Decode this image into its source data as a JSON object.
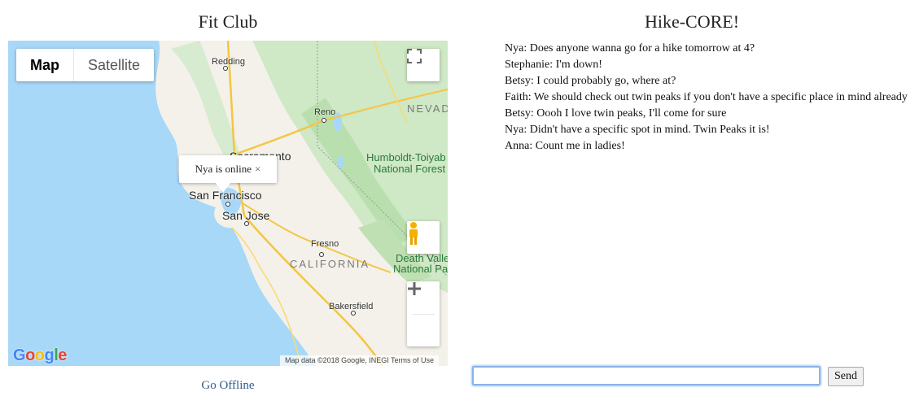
{
  "left_title": "Fit Club",
  "right_title": "Hike-CORE!",
  "map": {
    "type_control": {
      "map_label": "Map",
      "satellite_label": "Satellite",
      "selected": "Map"
    },
    "info_window": {
      "text": "Nya is online",
      "close_glyph": "×"
    },
    "labels": {
      "redding": "Redding",
      "reno": "Reno",
      "nevada": "NEVAD",
      "sacramento": "Sacramento",
      "san_francisco": "San Francisco",
      "san_jose": "San Jose",
      "fresno": "Fresno",
      "california": "CALIFORNIA",
      "bakersfield": "Bakersfield",
      "humboldt": "Humboldt-Toiyab",
      "humboldt2": "National Forest",
      "death_valley": "Death Valle",
      "death_valley2": "National Pa"
    },
    "attribution": "Map data ©2018 Google, INEGI    Terms of Use",
    "logo": "Google",
    "zoom_in": "+",
    "zoom_out": "−",
    "icons": [
      "fullscreen-icon",
      "pegman-icon",
      "zoom-in-icon",
      "zoom-out-icon"
    ]
  },
  "go_offline_label": "Go Offline",
  "messages": [
    "Nya: Does anyone wanna go for a hike tomorrow at 4?",
    "Stephanie: I'm down!",
    "Betsy: I could probably go, where at?",
    "Faith: We should check out twin peaks if you don't have a specific place in mind already",
    "Betsy: Oooh I love twin peaks, I'll come for sure",
    "Nya: Didn't have a specific spot in mind. Twin Peaks it is!",
    "Anna: Count me in ladies!"
  ],
  "input": {
    "value": "",
    "placeholder": ""
  },
  "send_label": "Send",
  "colors": {
    "water": "#a8d8f8",
    "land": "#f3f1ea",
    "forest": "#c9e6c1",
    "link": "#2e5f8a",
    "input_focus": "#8ab4e8"
  }
}
